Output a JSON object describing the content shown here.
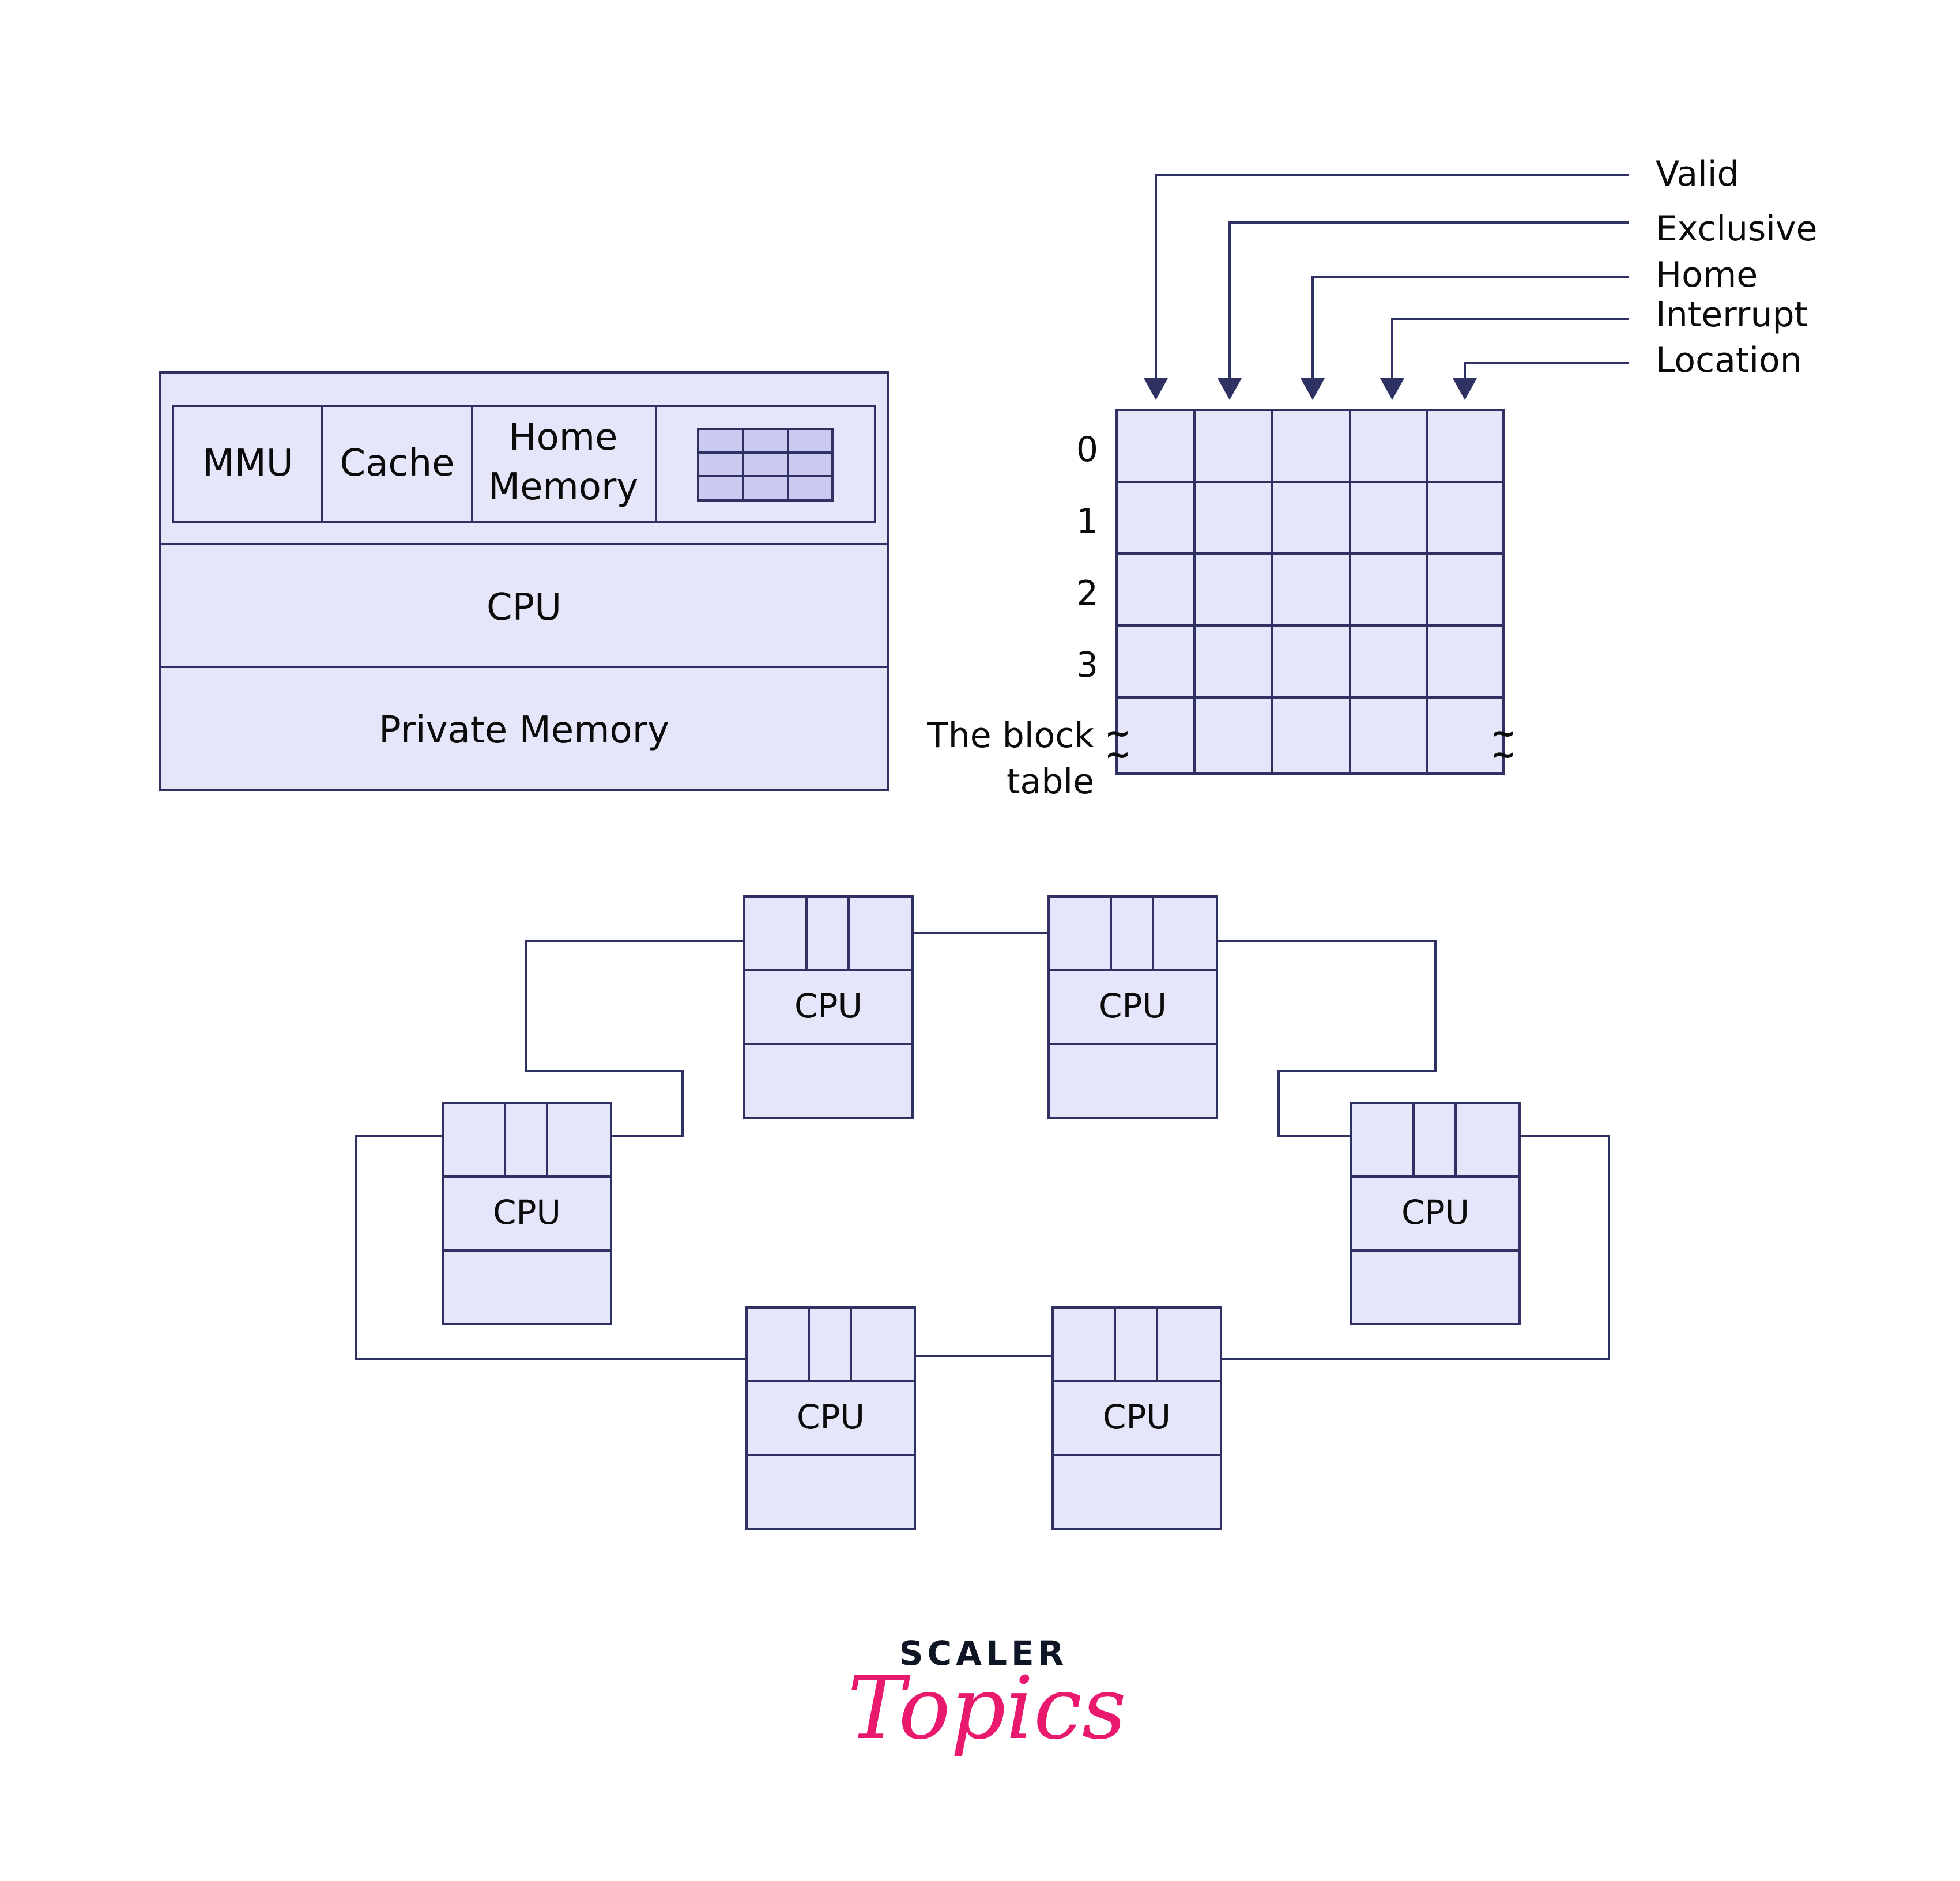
{
  "node": {
    "top_row": [
      {
        "label": "MMU"
      },
      {
        "label": "Cache"
      },
      {
        "label_lines": [
          "Home",
          "Memory"
        ]
      },
      {
        "icon": "directory-table-icon"
      }
    ],
    "cpu_label": "CPU",
    "private_memory_label": "Private Memory"
  },
  "block_table": {
    "field_labels": [
      "Valid",
      "Exclusive",
      "Home",
      "Interrupt",
      "Location"
    ],
    "row_labels": [
      "0",
      "1",
      "2",
      "3"
    ],
    "caption_lines": [
      "The block",
      "table"
    ],
    "columns": 5,
    "rows": 5,
    "continuation_mark": "~"
  },
  "ring": {
    "nodes": [
      {
        "id": "top-left",
        "label": "CPU"
      },
      {
        "id": "top-right",
        "label": "CPU"
      },
      {
        "id": "left",
        "label": "CPU"
      },
      {
        "id": "right",
        "label": "CPU"
      },
      {
        "id": "bottom-left",
        "label": "CPU"
      },
      {
        "id": "bottom-right",
        "label": "CPU"
      }
    ]
  },
  "logo": {
    "brand": "SCALER",
    "sub": "Topics"
  },
  "colors": {
    "fill": "#e6e6fa",
    "mini_fill": "#cbcbf2",
    "stroke": "#2e3162",
    "logo_dark": "#0e1626",
    "logo_pink": "#e9196e"
  }
}
